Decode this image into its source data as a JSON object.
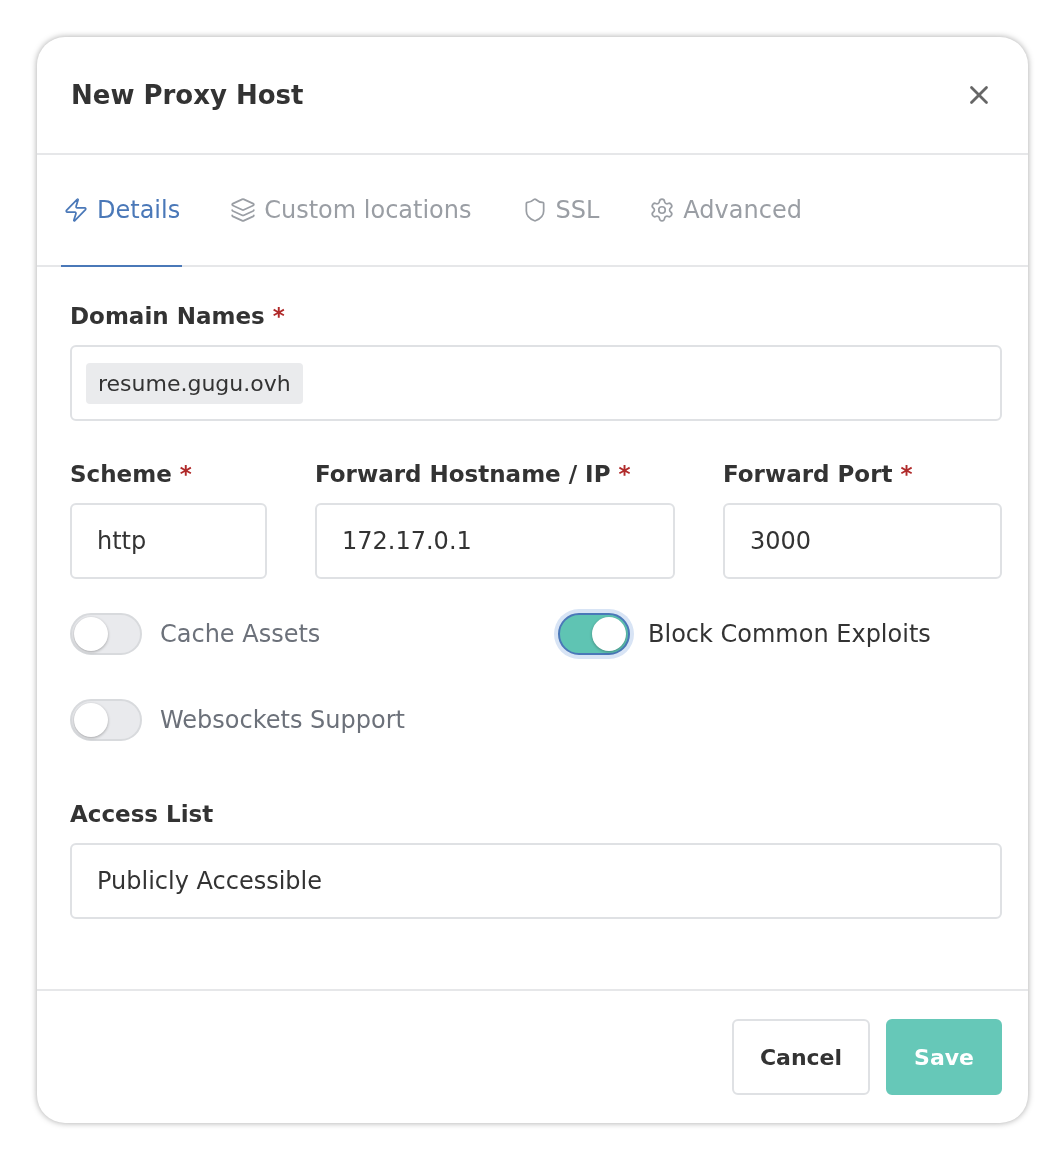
{
  "dialog": {
    "title": "New Proxy Host"
  },
  "tabs": [
    {
      "label": "Details",
      "kind": "details",
      "selected": true
    },
    {
      "label": "Custom locations",
      "kind": "locations",
      "selected": false
    },
    {
      "label": "SSL",
      "kind": "ssl",
      "selected": false
    },
    {
      "label": "Advanced",
      "kind": "advanced",
      "selected": false
    }
  ],
  "domain_names": {
    "label": "Domain Names",
    "required_mark": "*",
    "tags": [
      "resume.gugu.ovh"
    ]
  },
  "forward_fields": [
    {
      "label": "Scheme",
      "required_mark": "*",
      "value": "http"
    },
    {
      "label": "Forward Hostname / IP",
      "required_mark": "*",
      "value": "172.17.0.1"
    },
    {
      "label": "Forward Port",
      "required_mark": "*",
      "value": "3000"
    }
  ],
  "toggles": [
    {
      "label": "Cache Assets",
      "on": false
    },
    {
      "label": "Block Common Exploits",
      "on": true
    },
    {
      "label": "Websockets Support",
      "on": false
    }
  ],
  "access_list": {
    "label": "Access List",
    "value": "Publicly Accessible"
  },
  "buttons": [
    {
      "label": "Cancel",
      "kind": "secondary"
    },
    {
      "label": "Save",
      "kind": "primary"
    }
  ]
}
